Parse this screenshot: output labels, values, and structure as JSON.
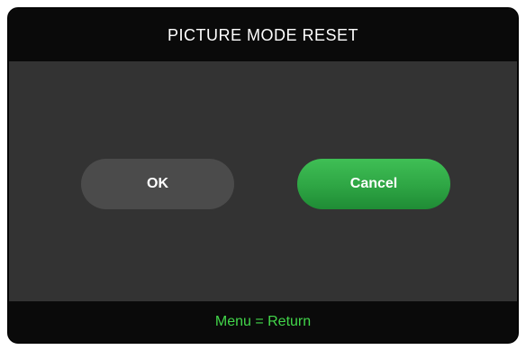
{
  "dialog": {
    "title": "PICTURE MODE RESET"
  },
  "buttons": {
    "ok_label": "OK",
    "cancel_label": "Cancel",
    "selected": "Cancel"
  },
  "footer": {
    "hint": "Menu = Return"
  },
  "colors": {
    "background": "#333333",
    "bar": "#0a0a0a",
    "ok_button": "#4b4b4b",
    "selected_button": "#2ea544",
    "hint_text": "#42d64a",
    "text": "#ffffff"
  }
}
